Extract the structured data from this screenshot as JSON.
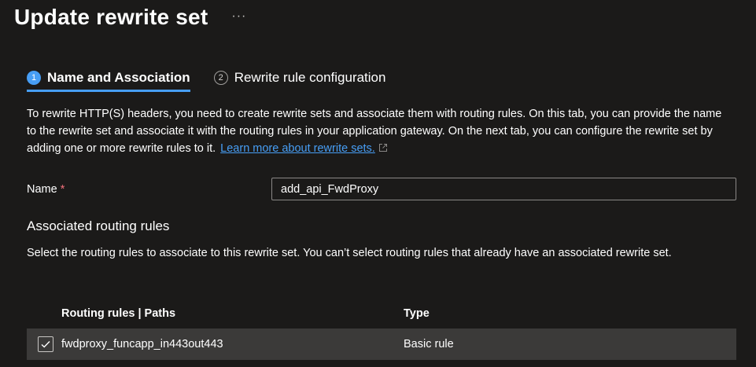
{
  "header": {
    "title": "Update rewrite set",
    "more_label": "···"
  },
  "tabs": [
    {
      "step": "1",
      "label": "Name and Association",
      "active": true
    },
    {
      "step": "2",
      "label": "Rewrite rule configuration",
      "active": false
    }
  ],
  "description": {
    "text": "To rewrite HTTP(S) headers, you need to create rewrite sets and associate them with routing rules. On this tab, you can provide the name to the rewrite set and associate it with the routing rules in your application gateway. On the next tab, you can configure the rewrite set by adding one or more rewrite rules to it.",
    "link_label": "Learn more about rewrite sets."
  },
  "name_field": {
    "label": "Name",
    "required_mark": "*",
    "value": "add_api_FwdProxy"
  },
  "associated_section": {
    "title": "Associated routing rules",
    "description": "Select the routing rules to associate to this rewrite set. You can’t select routing rules that already have an associated rewrite set."
  },
  "table": {
    "columns": [
      "Routing rules | Paths",
      "Type"
    ],
    "rows": [
      {
        "name": "fwdproxy_funcapp_in443out443",
        "type": "Basic rule",
        "checked": true
      }
    ]
  },
  "colors": {
    "background": "#1b1a19",
    "accent": "#479ef5",
    "required": "#f1707b",
    "row_selected": "#3b3a39"
  }
}
